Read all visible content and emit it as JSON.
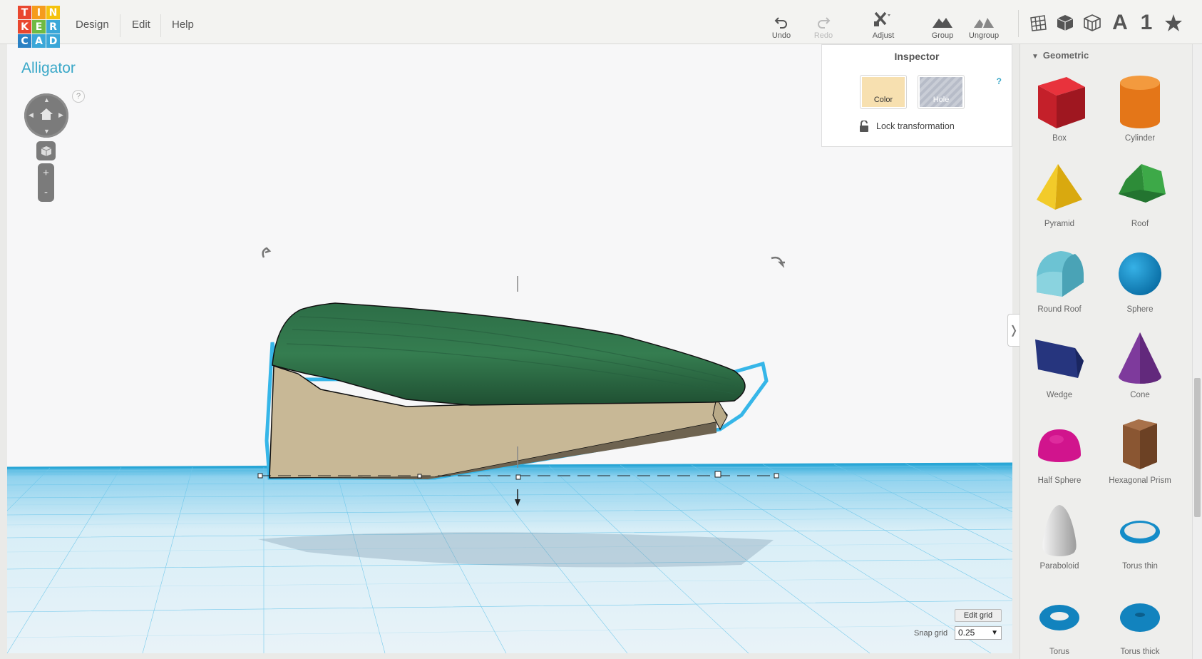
{
  "logo": {
    "letters": [
      "T",
      "I",
      "N",
      "K",
      "E",
      "R",
      "C",
      "A",
      "D"
    ],
    "colors": [
      "#e9472f",
      "#f59c1d",
      "#f5c20d",
      "#e9472f",
      "#6fba44",
      "#3aa7d8",
      "#2a81c4",
      "#3aa7d8",
      "#3aa7d8"
    ]
  },
  "menu": {
    "design": "Design",
    "edit": "Edit",
    "help": "Help"
  },
  "toolbar": {
    "undo": "Undo",
    "redo": "Redo",
    "adjust": "Adjust",
    "group": "Group",
    "ungroup": "Ungroup"
  },
  "view_toolbar": {
    "text_icon": "A",
    "number_icon": "1"
  },
  "design": {
    "title": "Alligator"
  },
  "nav": {
    "help": "?",
    "zoom_in": "+",
    "zoom_out": "-"
  },
  "inspector": {
    "title": "Inspector",
    "help": "?",
    "color_label": "Color",
    "hole_label": "Hole",
    "lock_label": "Lock transformation",
    "color_swatch": "#f7e0b0"
  },
  "library": {
    "category": "Geometric",
    "shapes": [
      {
        "label": "Box",
        "icon": "box-icon"
      },
      {
        "label": "Cylinder",
        "icon": "cylinder-icon"
      },
      {
        "label": "Pyramid",
        "icon": "pyramid-icon"
      },
      {
        "label": "Roof",
        "icon": "roof-icon"
      },
      {
        "label": "Round Roof",
        "icon": "round-roof-icon"
      },
      {
        "label": "Sphere",
        "icon": "sphere-icon"
      },
      {
        "label": "Wedge",
        "icon": "wedge-icon"
      },
      {
        "label": "Cone",
        "icon": "cone-icon"
      },
      {
        "label": "Half Sphere",
        "icon": "half-sphere-icon"
      },
      {
        "label": "Hexagonal Prism",
        "icon": "hexagonal-prism-icon"
      },
      {
        "label": "Paraboloid",
        "icon": "paraboloid-icon"
      },
      {
        "label": "Torus thin",
        "icon": "torus-thin-icon"
      },
      {
        "label": "Torus",
        "icon": "torus-icon"
      },
      {
        "label": "Torus thick",
        "icon": "torus-thick-icon"
      }
    ]
  },
  "grid": {
    "edit_label": "Edit grid",
    "snap_label": "Snap grid",
    "snap_value": "0.25"
  },
  "colors": {
    "accent": "#3aa8c8",
    "model_top": "#2f7a4c",
    "model_side": "#c9b998",
    "grid_line": "#33b3e0"
  }
}
